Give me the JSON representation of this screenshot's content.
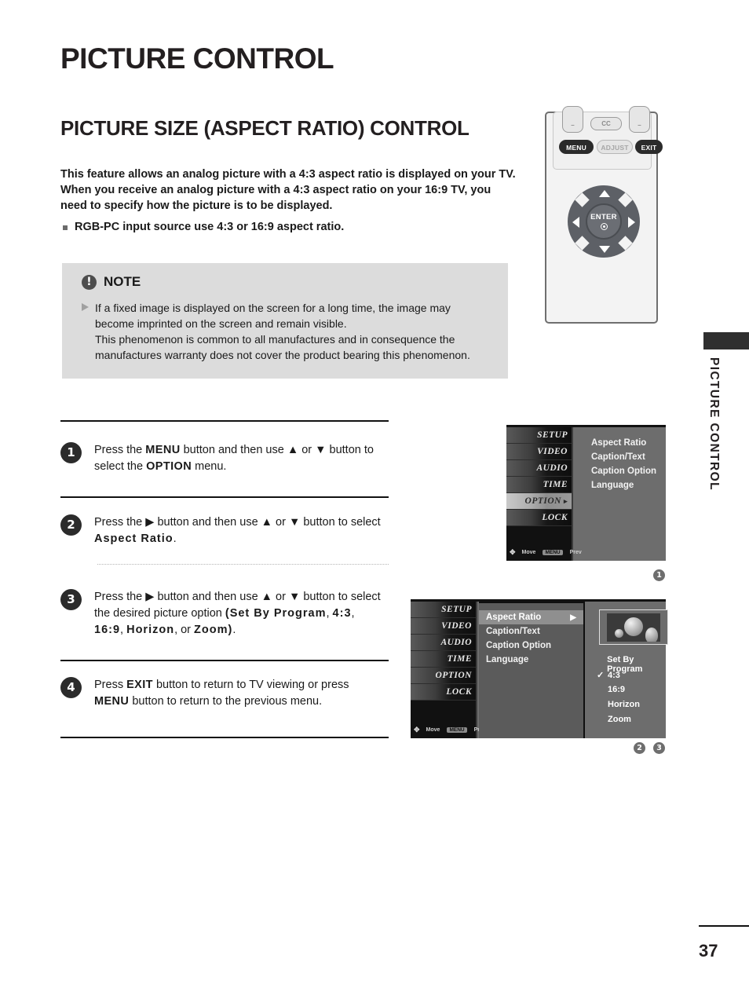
{
  "page": {
    "title": "PICTURE CONTROL",
    "section_title": "PICTURE SIZE (ASPECT RATIO) CONTROL",
    "side_label": "PICTURE CONTROL",
    "page_number": "37"
  },
  "intro": {
    "line1": "This feature allows an analog picture with a 4:3 aspect ratio is displayed on your TV.",
    "line2": "When you receive an analog picture with a 4:3 aspect ratio on your 16:9 TV, you",
    "line3": "need to specify how the picture is to be displayed.",
    "bullet": "RGB-PC input source use 4:3 or 16:9 aspect ratio."
  },
  "note": {
    "icon": "exclamation-circle-icon",
    "title": "NOTE",
    "arrow_icon": "triangle-right-icon",
    "line1": "If a fixed image is displayed on the screen for a long time, the image may",
    "line2": "become imprinted on the screen and remain visible.",
    "line3": "This phenomenon is common to all manufactures and in consequence the",
    "line4": "manufactures warranty does not cover the product bearing this phenomenon."
  },
  "steps": [
    {
      "num": "1",
      "html": "Press the <b>MENU</b> button and then use &#9650; or &#9660; button to select the <b>OPTION</b> menu."
    },
    {
      "num": "2",
      "html": "Press the &#9654; button and then use &#9650; or &#9660; button to select <span class=\"spaced\">Aspect Ratio</span>."
    },
    {
      "num": "3",
      "html": "Press the &#9654; button and then use &#9650; or &#9660; button to select the desired picture option <span class=\"spaced\">(Set By Program</span>, <span class=\"spaced\">4:3</span>, <span class=\"spaced\">16:9</span>, <span class=\"spaced\">Horizon</span>, or <span class=\"spaced\">Zoom)</span>."
    },
    {
      "num": "4",
      "html": "Press <b>EXIT</b> button to return to TV viewing or press <b>MENU</b> button to return to the previous menu."
    }
  ],
  "remote": {
    "cap_left": "–",
    "cap_cc": "CC",
    "cap_right": "–",
    "menu": "MENU",
    "adjust": "ADJUST",
    "exit": "EXIT",
    "enter": "ENTER",
    "up_icon": "arrow-up-icon",
    "down_icon": "arrow-down-icon",
    "left_icon": "arrow-left-icon",
    "right_icon": "arrow-right-icon"
  },
  "osd": {
    "sidebar": [
      {
        "label": "SETUP",
        "selected": false
      },
      {
        "label": "VIDEO",
        "selected": false
      },
      {
        "label": "AUDIO",
        "selected": false
      },
      {
        "label": "TIME",
        "selected": false
      },
      {
        "label": "OPTION",
        "selected": true
      },
      {
        "label": "LOCK",
        "selected": false
      }
    ],
    "footer": {
      "move": "Move",
      "prev": "Prev"
    },
    "menu_items": [
      "Aspect Ratio",
      "Caption/Text",
      "Caption Option",
      "Language"
    ],
    "aspect_options": [
      {
        "label": "Set By Program",
        "checked": false
      },
      {
        "label": "4:3",
        "checked": true
      },
      {
        "label": "16:9",
        "checked": false
      },
      {
        "label": "Horizon",
        "checked": false
      },
      {
        "label": "Zoom",
        "checked": false
      }
    ],
    "check_glyph": "✓",
    "right_arrow_glyph": "▶"
  },
  "badges": {
    "b1": "1",
    "b2": "2",
    "b3": "3"
  },
  "colors": {
    "text": "#231f20",
    "note_bg": "#dcdcdc",
    "osd_bg": "#6d6d6d",
    "osd_sidebar": "#111111",
    "highlight": "#8f8f8f",
    "badge": "#6e6e6e"
  }
}
